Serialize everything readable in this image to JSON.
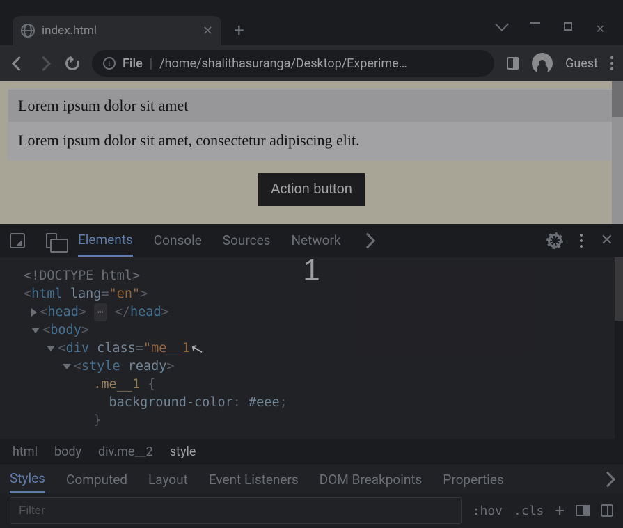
{
  "browser": {
    "tab_title": "index.html",
    "url_scheme": "File",
    "url_path": "/home/shalithasuranga/Desktop/Experime…",
    "guest_label": "Guest"
  },
  "page": {
    "heading": "Lorem ipsum dolor sit amet",
    "paragraph": "Lorem ipsum dolor sit amet, consectetur adipiscing elit.",
    "button_label": "Action button"
  },
  "devtools": {
    "tabs": [
      "Elements",
      "Console",
      "Sources",
      "Network"
    ],
    "overlay_number": "1",
    "tree": {
      "doctype": "<!DOCTYPE html>",
      "html_open": "html",
      "html_lang_attr": "lang",
      "html_lang_val": "\"en\"",
      "head": "head",
      "body": "body",
      "div": "div",
      "div_class_attr": "class",
      "div_class_val": "\"me__1",
      "style": "style",
      "style_attr": "ready",
      "css_selector": ".me__1",
      "css_prop": "background-color",
      "css_val": "#eee"
    },
    "breadcrumb": [
      "html",
      "body",
      "div.me__2",
      "style"
    ],
    "panels": [
      "Styles",
      "Computed",
      "Layout",
      "Event Listeners",
      "DOM Breakpoints",
      "Properties"
    ],
    "filter_placeholder": "Filter",
    "hov": ":hov",
    "cls": ".cls"
  }
}
